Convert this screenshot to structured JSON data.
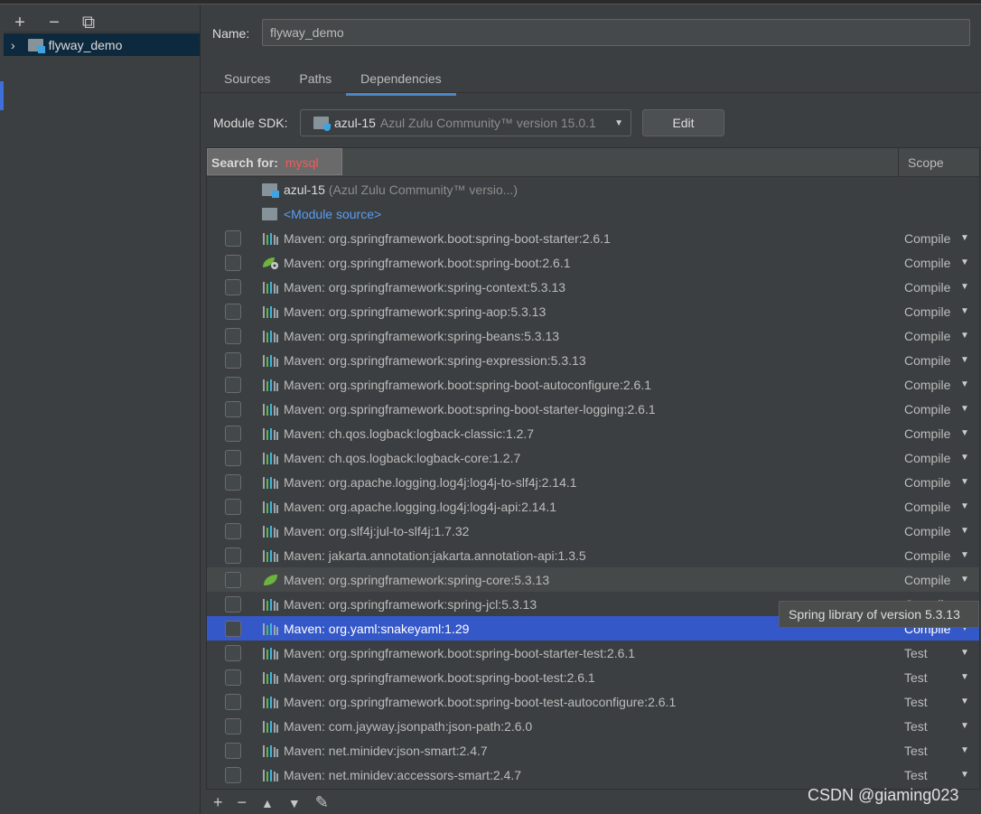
{
  "left_toolbar": {
    "add": "+",
    "remove": "−",
    "copy": "⧉"
  },
  "tree": {
    "module": "flyway_demo",
    "chevron": "›"
  },
  "name_label": "Name:",
  "name_value": "flyway_demo",
  "tabs": [
    "Sources",
    "Paths",
    "Dependencies"
  ],
  "active_tab": "Dependencies",
  "sdk": {
    "label": "Module SDK:",
    "name": "azul-15",
    "desc": "Azul Zulu Community™ version 15.0.1",
    "edit": "Edit"
  },
  "table": {
    "search_label": "Search for:",
    "search_value": "mysql",
    "scope_header": "Scope",
    "sdk_row": {
      "name": "azul-15",
      "desc": "(Azul Zulu Community™ versio...)"
    },
    "module_source": "<Module source>",
    "rows": [
      {
        "name": "Maven: org.springframework.boot:spring-boot-starter:2.6.1",
        "scope": "Compile",
        "icon": "maven-library"
      },
      {
        "name": "Maven: org.springframework.boot:spring-boot:2.6.1",
        "scope": "Compile",
        "icon": "spring-boot"
      },
      {
        "name": "Maven: org.springframework:spring-context:5.3.13",
        "scope": "Compile",
        "icon": "maven-library"
      },
      {
        "name": "Maven: org.springframework:spring-aop:5.3.13",
        "scope": "Compile",
        "icon": "maven-library"
      },
      {
        "name": "Maven: org.springframework:spring-beans:5.3.13",
        "scope": "Compile",
        "icon": "maven-library"
      },
      {
        "name": "Maven: org.springframework:spring-expression:5.3.13",
        "scope": "Compile",
        "icon": "maven-library"
      },
      {
        "name": "Maven: org.springframework.boot:spring-boot-autoconfigure:2.6.1",
        "scope": "Compile",
        "icon": "maven-library"
      },
      {
        "name": "Maven: org.springframework.boot:spring-boot-starter-logging:2.6.1",
        "scope": "Compile",
        "icon": "maven-library"
      },
      {
        "name": "Maven: ch.qos.logback:logback-classic:1.2.7",
        "scope": "Compile",
        "icon": "maven-library"
      },
      {
        "name": "Maven: ch.qos.logback:logback-core:1.2.7",
        "scope": "Compile",
        "icon": "maven-library"
      },
      {
        "name": "Maven: org.apache.logging.log4j:log4j-to-slf4j:2.14.1",
        "scope": "Compile",
        "icon": "maven-library"
      },
      {
        "name": "Maven: org.apache.logging.log4j:log4j-api:2.14.1",
        "scope": "Compile",
        "icon": "maven-library"
      },
      {
        "name": "Maven: org.slf4j:jul-to-slf4j:1.7.32",
        "scope": "Compile",
        "icon": "maven-library"
      },
      {
        "name": "Maven: jakarta.annotation:jakarta.annotation-api:1.3.5",
        "scope": "Compile",
        "icon": "maven-library"
      },
      {
        "name": "Maven: org.springframework:spring-core:5.3.13",
        "scope": "Compile",
        "icon": "spring-leaf",
        "state": "hover"
      },
      {
        "name": "Maven: org.springframework:spring-jcl:5.3.13",
        "scope": "Compile",
        "icon": "maven-library"
      },
      {
        "name": "Maven: org.yaml:snakeyaml:1.29",
        "scope": "Compile",
        "icon": "maven-library",
        "state": "selected"
      },
      {
        "name": "Maven: org.springframework.boot:spring-boot-starter-test:2.6.1",
        "scope": "Test",
        "icon": "maven-library"
      },
      {
        "name": "Maven: org.springframework.boot:spring-boot-test:2.6.1",
        "scope": "Test",
        "icon": "maven-library"
      },
      {
        "name": "Maven: org.springframework.boot:spring-boot-test-autoconfigure:2.6.1",
        "scope": "Test",
        "icon": "maven-library"
      },
      {
        "name": "Maven: com.jayway.jsonpath:json-path:2.6.0",
        "scope": "Test",
        "icon": "maven-library"
      },
      {
        "name": "Maven: net.minidev:json-smart:2.4.7",
        "scope": "Test",
        "icon": "maven-library"
      },
      {
        "name": "Maven: net.minidev:accessors-smart:2.4.7",
        "scope": "Test",
        "icon": "maven-library"
      }
    ]
  },
  "tooltip": "Spring library of version 5.3.13",
  "bottom_toolbar": {
    "add": "+",
    "remove": "−",
    "up": "▲",
    "down": "▼",
    "edit": "✎"
  },
  "watermark": "CSDN @giaming023",
  "colors": {
    "selected": "#3558c9",
    "search_text": "#f25b5b",
    "link": "#589df6"
  }
}
